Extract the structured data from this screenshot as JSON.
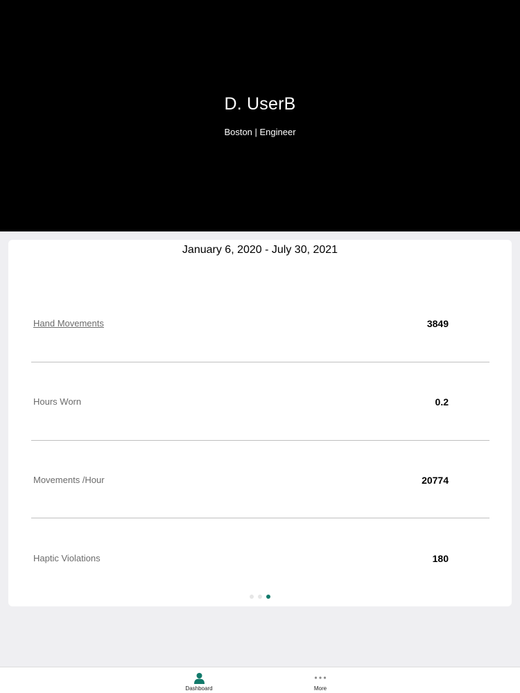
{
  "header": {
    "name": "D. UserB",
    "subtitle": "Boston | Engineer"
  },
  "summary": {
    "date_range": "January 6, 2020 - July 30, 2021",
    "stats": [
      {
        "label": "Hand Movements",
        "value": "3849"
      },
      {
        "label": "Hours Worn",
        "value": "0.2"
      },
      {
        "label": "Movements /Hour",
        "value": "20774"
      },
      {
        "label": "Haptic Violations",
        "value": "180"
      }
    ],
    "pager": {
      "pages": 3,
      "active_page": 3
    }
  },
  "tabbar": {
    "tabs": [
      {
        "label": "Dashboard",
        "icon": "person-icon",
        "selected": true
      },
      {
        "label": "More",
        "icon": "more-dots-icon",
        "selected": false
      }
    ]
  },
  "colors": {
    "accent": "#127a6b",
    "header_bg": "#000000",
    "page_bg": "#efeff2"
  }
}
